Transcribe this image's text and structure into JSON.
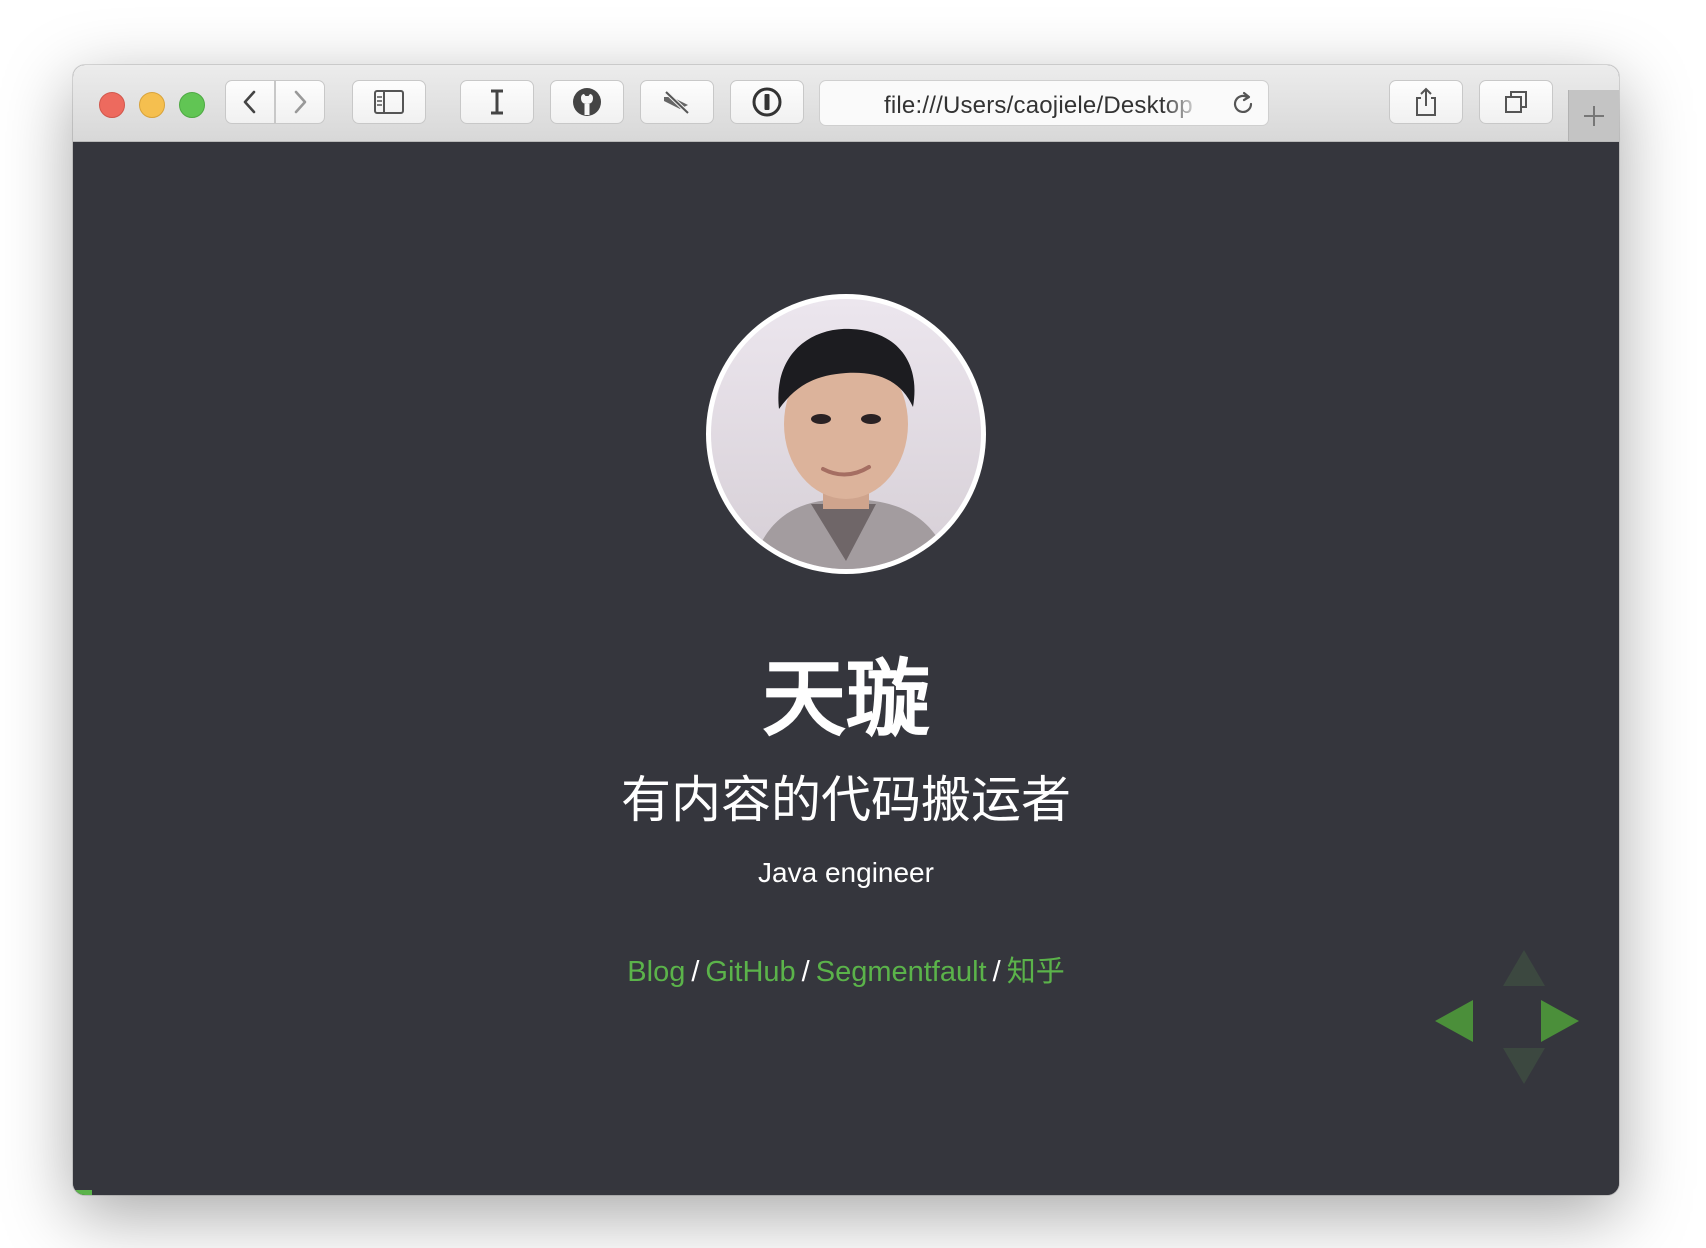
{
  "browser": {
    "url": "file:///Users/caojiele/Desktop",
    "toolbar_icons": [
      "back-chevron-icon",
      "forward-chevron-icon",
      "sidebar-icon",
      "text-cursor-icon",
      "github-icon",
      "slash-tag-icon",
      "info-icon",
      "reload-icon",
      "share-icon",
      "tabs-icon",
      "plus-icon"
    ]
  },
  "profile": {
    "name": "天璇",
    "tagline": "有内容的代码搬运者",
    "role": "Java engineer",
    "links": [
      {
        "label": "Blog"
      },
      {
        "label": "GitHub"
      },
      {
        "label": "Segmentfault"
      },
      {
        "label": "知乎"
      }
    ],
    "link_separator": "/"
  },
  "slides": {
    "progress": 0.012,
    "accent_color": "#5bb34a",
    "background_color": "#35363d"
  }
}
